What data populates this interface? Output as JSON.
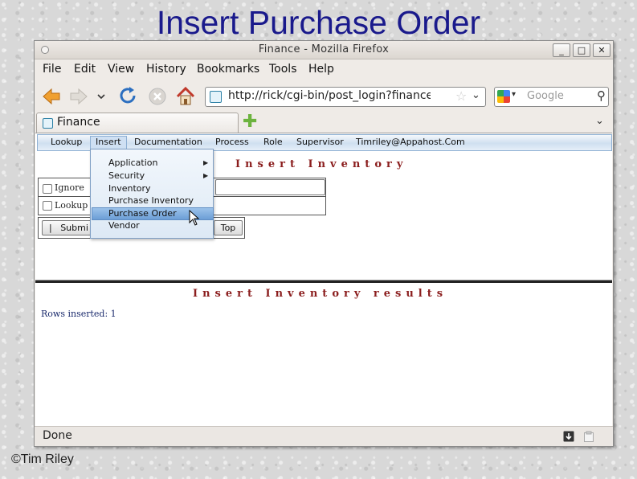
{
  "slide": {
    "title": "Insert Purchase Order",
    "copyright": "©Tim Riley"
  },
  "window": {
    "title": "Finance - Mozilla Firefox",
    "controls": [
      "_",
      "□",
      "✕"
    ]
  },
  "menubar": {
    "items": [
      "File",
      "Edit",
      "View",
      "History",
      "Bookmarks",
      "Tools",
      "Help"
    ]
  },
  "navigation": {
    "url": "http://rick/cgi-bin/post_login?finance:financ",
    "search_placeholder": "Google"
  },
  "tab": {
    "label": "Finance"
  },
  "app_menu": {
    "items": [
      "Lookup",
      "Insert",
      "Documentation",
      "Process",
      "Role",
      "Supervisor",
      "Timriley@Appahost.Com"
    ],
    "active": "Insert"
  },
  "insert_dropdown": {
    "items": [
      "Application",
      "Security",
      "Inventory",
      "Purchase Inventory",
      "Purchase Order",
      "Vendor"
    ],
    "submenu_items": [
      "Application",
      "Security"
    ],
    "highlighted": "Purchase Order"
  },
  "form": {
    "heading": "Insert Inventory",
    "checkboxes": [
      "Ignore",
      "Lookup"
    ],
    "buttons": [
      "Submit",
      "Top"
    ],
    "submit_visible_text": "Submi"
  },
  "results": {
    "heading": "Insert Inventory results",
    "message": "Rows inserted: 1"
  },
  "statusbar": {
    "text": "Done"
  },
  "colors": {
    "slide_title": "#1a1a8c",
    "heading_text": "#8b1e1e",
    "menu_highlight": "#6c9ed6"
  }
}
